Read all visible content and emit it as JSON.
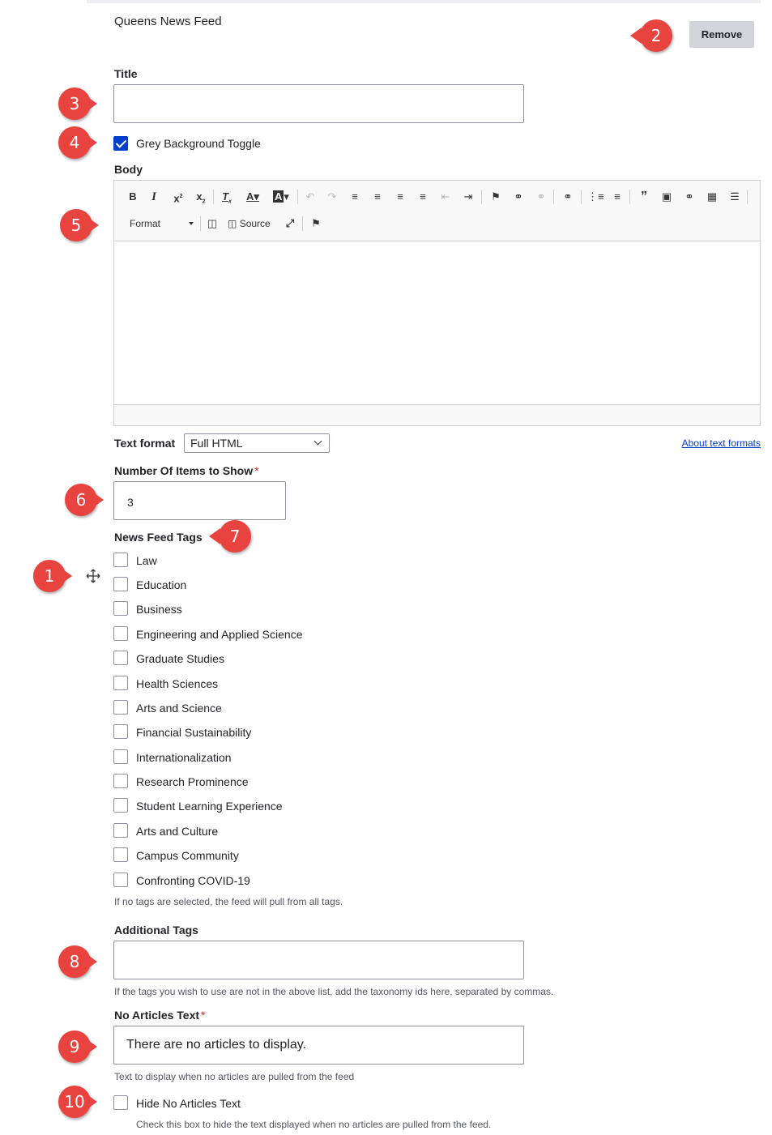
{
  "section": {
    "title": "Queens News Feed",
    "remove_label": "Remove"
  },
  "title_field": {
    "label": "Title",
    "value": ""
  },
  "grey_toggle": {
    "label": "Grey Background Toggle",
    "checked": true
  },
  "body": {
    "label": "Body",
    "toolbar": {
      "format_label": "Format",
      "source_label": "Source",
      "row1_icons": [
        "bold-icon",
        "italic-icon",
        "superscript-icon",
        "subscript-icon",
        "remove-format-icon",
        "text-color-icon",
        "background-color-icon",
        "undo-icon",
        "redo-icon",
        "align-left-icon",
        "align-center-icon",
        "align-right-icon",
        "justify-icon",
        "outdent-icon",
        "indent-icon",
        "anchor-icon",
        "link-icon",
        "unlink-icon",
        "link-icon-2",
        "bulleted-list-icon",
        "numbered-list-icon",
        "blockquote-icon",
        "image-icon",
        "link-icon-3",
        "table-icon",
        "horizontal-rule-icon"
      ],
      "row2_icons": [
        "format-dropdown",
        "show-blocks-icon",
        "source-icon",
        "maximize-icon",
        "anchor-icon-2"
      ]
    }
  },
  "text_format": {
    "label": "Text format",
    "selected": "Full HTML",
    "about_link": "About text formats"
  },
  "num_items": {
    "label": "Number Of Items to Show",
    "required_mark": "*",
    "value": "3"
  },
  "news_tags": {
    "label": "News Feed Tags",
    "items": [
      "Law",
      "Education",
      "Business",
      "Engineering and Applied Science",
      "Graduate Studies",
      "Health Sciences",
      "Arts and Science",
      "Financial Sustainability",
      "Internationalization",
      "Research Prominence",
      "Student Learning Experience",
      "Arts and Culture",
      "Campus Community",
      "Confronting COVID-19"
    ],
    "help": "If no tags are selected, the feed will pull from all tags."
  },
  "additional_tags": {
    "label": "Additional Tags",
    "value": "",
    "help": "If the tags you wish to use are not in the above list, add the taxonomy ids here, separated by commas."
  },
  "no_articles": {
    "label": "No Articles Text",
    "required_mark": "*",
    "value": "There are no articles to display.",
    "help": "Text to display when no articles are pulled from the feed"
  },
  "hide_no_articles": {
    "label": "Hide No Articles Text",
    "checked": false,
    "help": "Check this box to hide the text displayed when no articles are pulled from the feed."
  },
  "callouts": [
    "1",
    "2",
    "3",
    "4",
    "5",
    "6",
    "7",
    "8",
    "9",
    "10"
  ],
  "colors": {
    "callout": "#e8433e",
    "checkbox_checked": "#003ecc",
    "link": "#003ecc",
    "required": "#dc2323"
  }
}
